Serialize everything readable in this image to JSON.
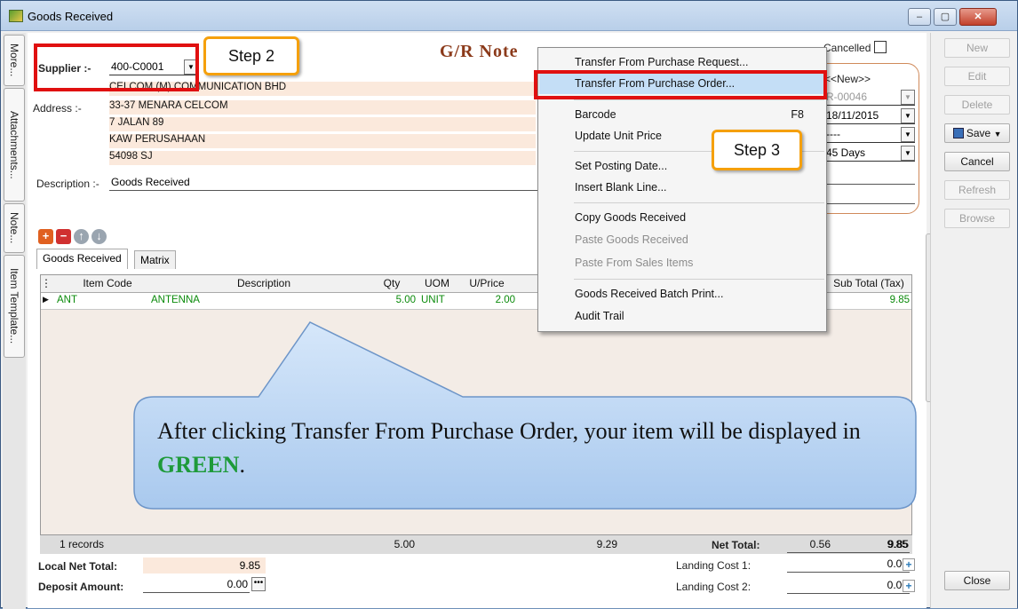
{
  "window": {
    "title": "Goods Received",
    "controls": [
      "–",
      "▢",
      "✕"
    ]
  },
  "side_tabs": [
    "More...",
    "Attachments...",
    "Note...",
    "Item Template..."
  ],
  "header": {
    "doc_title": "G/R Note",
    "supplier_label": "Supplier :-",
    "supplier_code": "400-C0001",
    "supplier_name": "CELCOM (M) COMMUNICATION BHD",
    "address_label": "Address :-",
    "address_lines": [
      "33-37 MENARA CELCOM",
      "7 JALAN 89",
      "KAW PERUSAHAAN",
      "54098 SJ"
    ],
    "description_label": "Description :-",
    "description_value": "Goods Received",
    "cancelled_label": "Cancelled",
    "doc_no": "<<New>>",
    "ref_no": "R-00046",
    "date": "18/11/2015",
    "agent": "----",
    "terms": "45 Days"
  },
  "tabs": [
    "Goods Received",
    "Matrix"
  ],
  "grid": {
    "columns": [
      "Item Code",
      "Description",
      "Qty",
      "UOM",
      "U/Price",
      "Sub Total (Tax)"
    ],
    "rows": [
      {
        "item_code": "ANT",
        "description": "ANTENNA",
        "qty": "5.00",
        "uom": "UNIT",
        "uprice": "2.00",
        "subtotal_tax": "9.85"
      }
    ],
    "footer": {
      "records": "1 records",
      "qty": "5.00",
      "amount": "9.29",
      "tax": "0.56",
      "total": "9.85"
    }
  },
  "context_menu": {
    "items": [
      {
        "label": "Transfer From Purchase Request...",
        "shortcut": "",
        "enabled": true
      },
      {
        "label": "Transfer From Purchase Order...",
        "shortcut": "",
        "enabled": true,
        "highlighted": true
      },
      {
        "label": "Barcode",
        "shortcut": "F8",
        "enabled": true
      },
      {
        "label": "Update Unit Price",
        "shortcut": "",
        "enabled": true
      },
      {
        "label": "Set Posting Date...",
        "shortcut": "",
        "enabled": true
      },
      {
        "label": "Insert Blank Line...",
        "shortcut": "",
        "enabled": true
      },
      {
        "label": "Copy Goods Received",
        "shortcut": "",
        "enabled": true
      },
      {
        "label": "Paste Goods Received",
        "shortcut": "",
        "enabled": false
      },
      {
        "label": "Paste From Sales Items",
        "shortcut": "",
        "enabled": false
      },
      {
        "label": "Goods Received Batch Print...",
        "shortcut": "",
        "enabled": true
      },
      {
        "label": "Audit Trail",
        "shortcut": "",
        "enabled": true
      }
    ]
  },
  "buttons": {
    "new": "New",
    "edit": "Edit",
    "delete": "Delete",
    "save": "Save",
    "cancel": "Cancel",
    "refresh": "Refresh",
    "browse": "Browse",
    "close": "Close"
  },
  "totals": {
    "net_total_label": "Net Total:",
    "net_total": "9.85",
    "landing_cost1_label": "Landing Cost 1:",
    "landing_cost1": "0.00",
    "landing_cost2_label": "Landing Cost 2:",
    "landing_cost2": "0.00",
    "local_net_total_label": "Local Net Total:",
    "local_net_total": "9.85",
    "deposit_label": "Deposit Amount:",
    "deposit": "0.00"
  },
  "annotations": {
    "step2": "Step 2",
    "step3": "Step 3",
    "callout_prefix": "After clicking Transfer From Purchase Order, your item will be displayed in ",
    "callout_highlight": "GREEN",
    "callout_suffix": "."
  },
  "colors": {
    "accent_red": "#e01010",
    "step_orange": "#f5a00c",
    "grid_green": "#0a8a0a",
    "callout_blue": "#bcd6f2"
  }
}
